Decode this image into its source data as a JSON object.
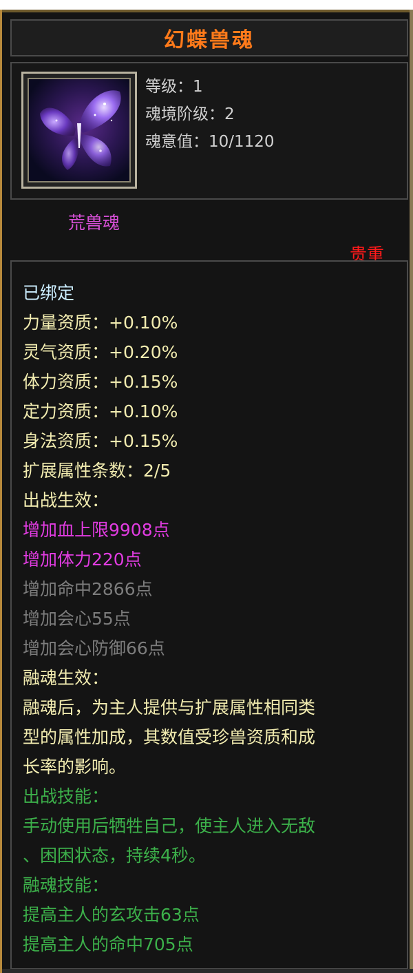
{
  "title": "幻蝶兽魂",
  "icon": {
    "name": "butterfly-soul-icon",
    "accent": "#7a4fe0"
  },
  "stats": [
    {
      "label": "等级：1"
    },
    {
      "label": "魂境阶级：2"
    },
    {
      "label": "魂意值：10/1120"
    }
  ],
  "category": "荒兽魂",
  "rarity": "贵重",
  "bound": "已绑定",
  "aptitudes": [
    "力量资质：+0.10%",
    "灵气资质：+0.20%",
    "体力资质：+0.15%",
    "定力资质：+0.10%",
    "身法资质：+0.15%"
  ],
  "extended_attr_count": "扩展属性条数：2/5",
  "battle_effect": {
    "heading": "出战生效：",
    "active": [
      "增加血上限9908点",
      "增加体力220点"
    ],
    "inactive": [
      "增加命中2866点",
      "增加会心55点",
      "增加会心防御66点"
    ]
  },
  "fusion_effect": {
    "heading": "融魂生效：",
    "lines": [
      "融魂后，为主人提供与扩展属性相同类",
      "型的属性加成，其数值受珍兽资质和成",
      "长率的影响。"
    ]
  },
  "battle_skill": {
    "heading": "出战技能：",
    "lines": [
      "手动使用后牺牲自己，使主人进入无敌",
      "、困困状态，持续4秒。"
    ]
  },
  "fusion_skill": {
    "heading": "融魂技能：",
    "lines": [
      "提高主人的玄攻击63点",
      "提高主人的命中705点"
    ]
  },
  "colors": {
    "title": "#ff7a1a",
    "category": "#d64fd6",
    "rarity": "#ff1a1a",
    "bound": "#cceeff",
    "normal": "#f2ecb0",
    "active_effect": "#e23ce2",
    "inactive_effect": "#7c7c7c",
    "skill": "#3cb04a"
  }
}
